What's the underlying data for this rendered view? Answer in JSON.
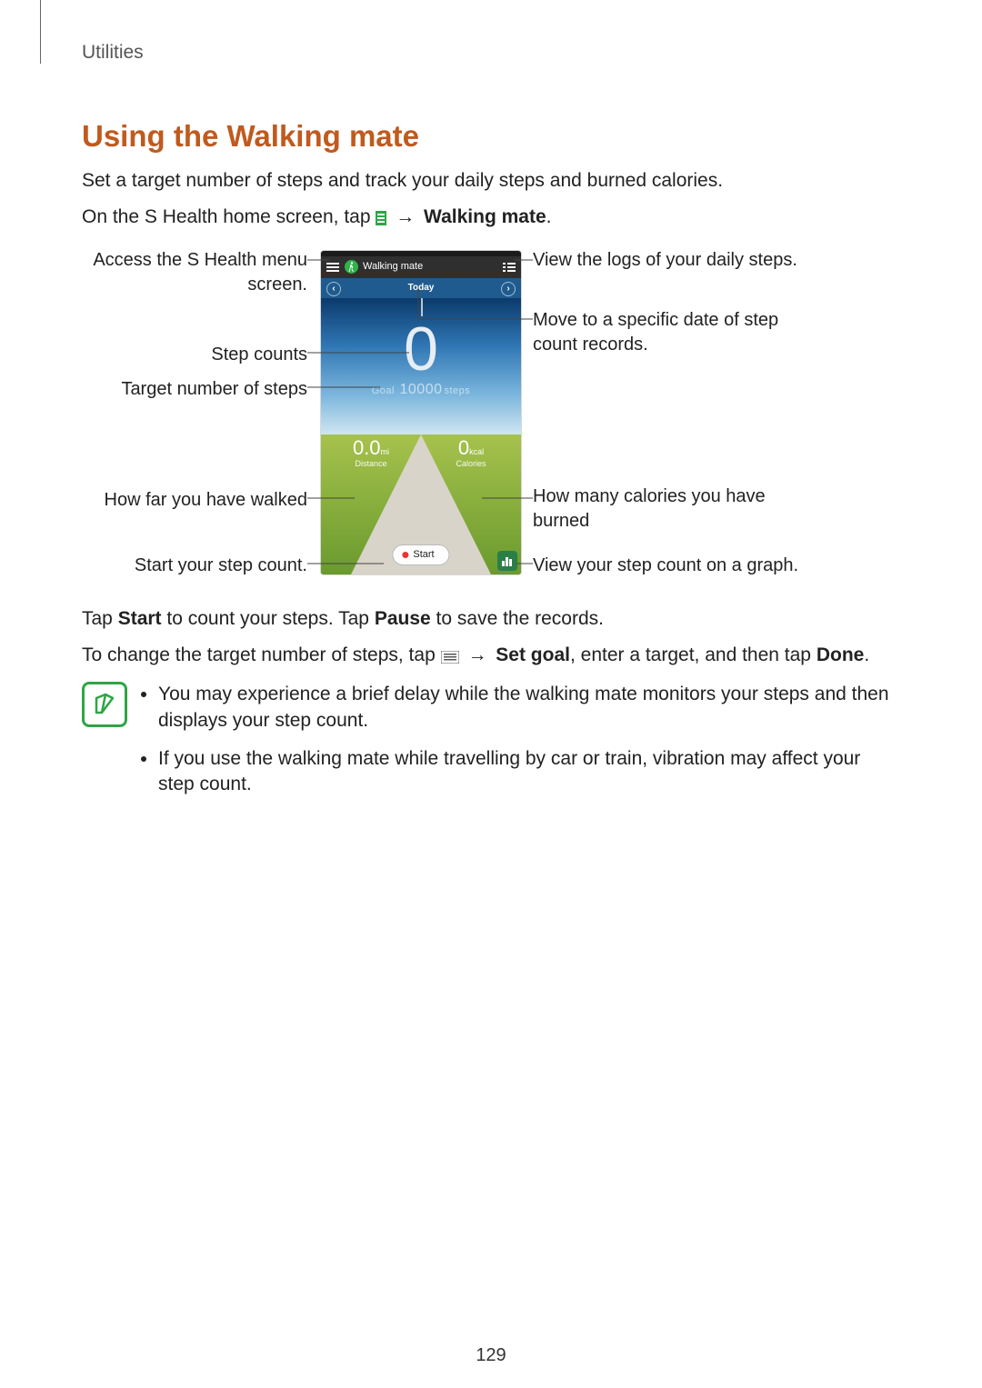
{
  "breadcrumb": "Utilities",
  "section_title": "Using the Walking mate",
  "intro": "Set a target number of steps and track your daily steps and burned calories.",
  "instruction": {
    "prefix": "On the S Health home screen, tap ",
    "arrow": "→",
    "target": "Walking mate",
    "suffix": "."
  },
  "callouts": {
    "menu": "Access the S Health menu screen.",
    "logs": "View the logs of your daily steps.",
    "date": "Move to a specific date of step count records.",
    "steps": "Step counts",
    "goal": "Target number of steps",
    "distance": "How far you have walked",
    "calories": "How many calories you have burned",
    "start": "Start your step count.",
    "graph": "View your step count on a graph."
  },
  "phone": {
    "app_title": "Walking mate",
    "date_label": "Today",
    "step_count": "0",
    "goal_prefix": "Goal",
    "goal_value": "10000",
    "goal_suffix": "steps",
    "distance_value": "0.0",
    "distance_unit": "mi",
    "distance_label": "Distance",
    "calories_value": "0",
    "calories_unit": "kcal",
    "calories_label": "Calories",
    "start_label": "Start"
  },
  "after_fig": {
    "line1_a": "Tap ",
    "line1_b": "Start",
    "line1_c": " to count your steps. Tap ",
    "line1_d": "Pause",
    "line1_e": " to save the records.",
    "line2_a": "To change the target number of steps, tap ",
    "line2_b": "→",
    "line2_c": "Set goal",
    "line2_d": ", enter a target, and then tap ",
    "line2_e": "Done",
    "line2_f": "."
  },
  "notes": [
    "You may experience a brief delay while the walking mate monitors your steps and then displays your step count.",
    "If you use the walking mate while travelling by car or train, vibration may affect your step count."
  ],
  "page_number": "129"
}
